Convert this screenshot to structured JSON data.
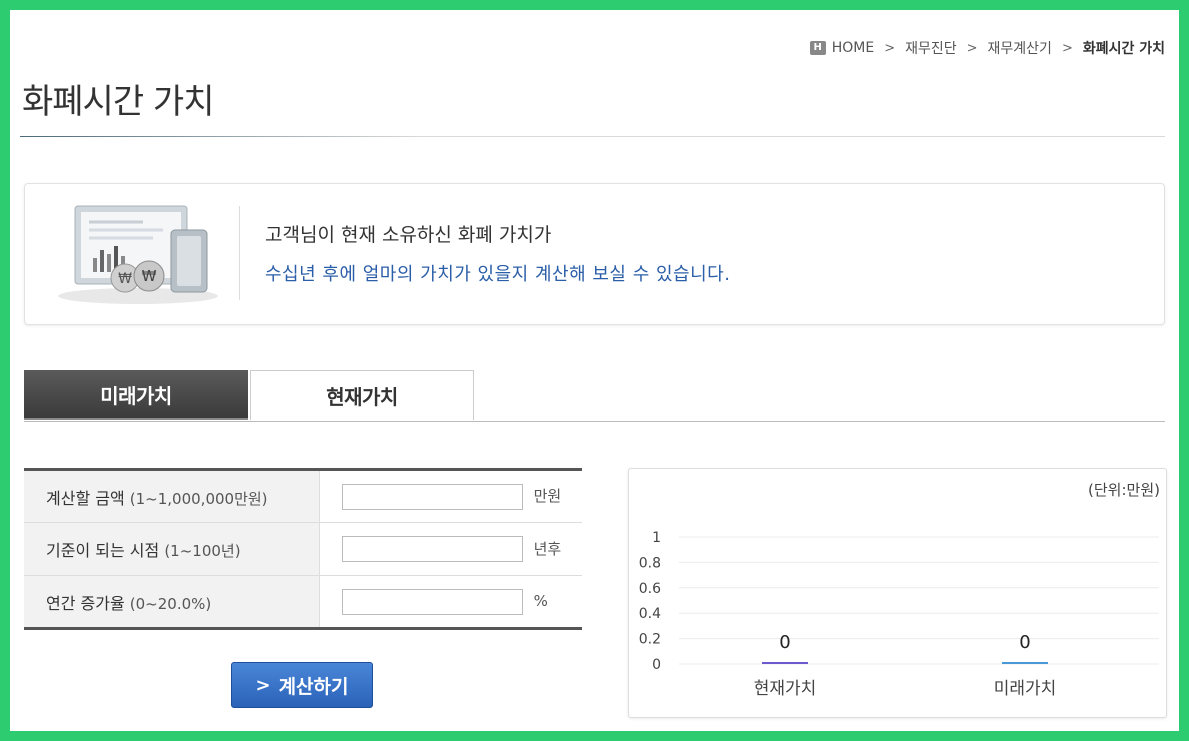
{
  "breadcrumb": {
    "home_icon": "H",
    "home": "HOME",
    "items": [
      "재무진단",
      "재무계산기"
    ],
    "current": "화폐시간 가치"
  },
  "page_title": "화폐시간 가치",
  "intro": {
    "line1": "고객님이 현재 소유하신 화폐 가치가",
    "line2": "수십년 후에 얼마의 가치가 있을지 계산해 보실 수 있습니다.",
    "illustration_icon": "finance-illustration-icon",
    "coin_symbol": "₩"
  },
  "tabs": [
    {
      "label": "미래가치",
      "active": true
    },
    {
      "label": "현재가치",
      "active": false
    }
  ],
  "form": {
    "rows": [
      {
        "label": "계산할 금액",
        "range": "(1~1,000,000만원)",
        "value": "",
        "unit": "만원"
      },
      {
        "label": "기준이 되는 시점",
        "range": "(1~100년)",
        "value": "",
        "unit": "년후"
      },
      {
        "label": "연간 증가율",
        "range": "(0~20.0%)",
        "value": "",
        "unit": "%"
      }
    ],
    "submit_label": "계산하기"
  },
  "chart_data": {
    "type": "bar",
    "unit_label": "(단위:만원)",
    "categories": [
      "현재가치",
      "미래가치"
    ],
    "values": [
      0,
      0
    ],
    "value_labels": [
      "0",
      "0"
    ],
    "ylim": [
      0,
      1
    ],
    "yticks": [
      "0",
      "0.2",
      "0.4",
      "0.6",
      "0.8",
      "1"
    ],
    "colors": [
      "#6a5acd",
      "#4a9ad8"
    ],
    "grid": true
  }
}
